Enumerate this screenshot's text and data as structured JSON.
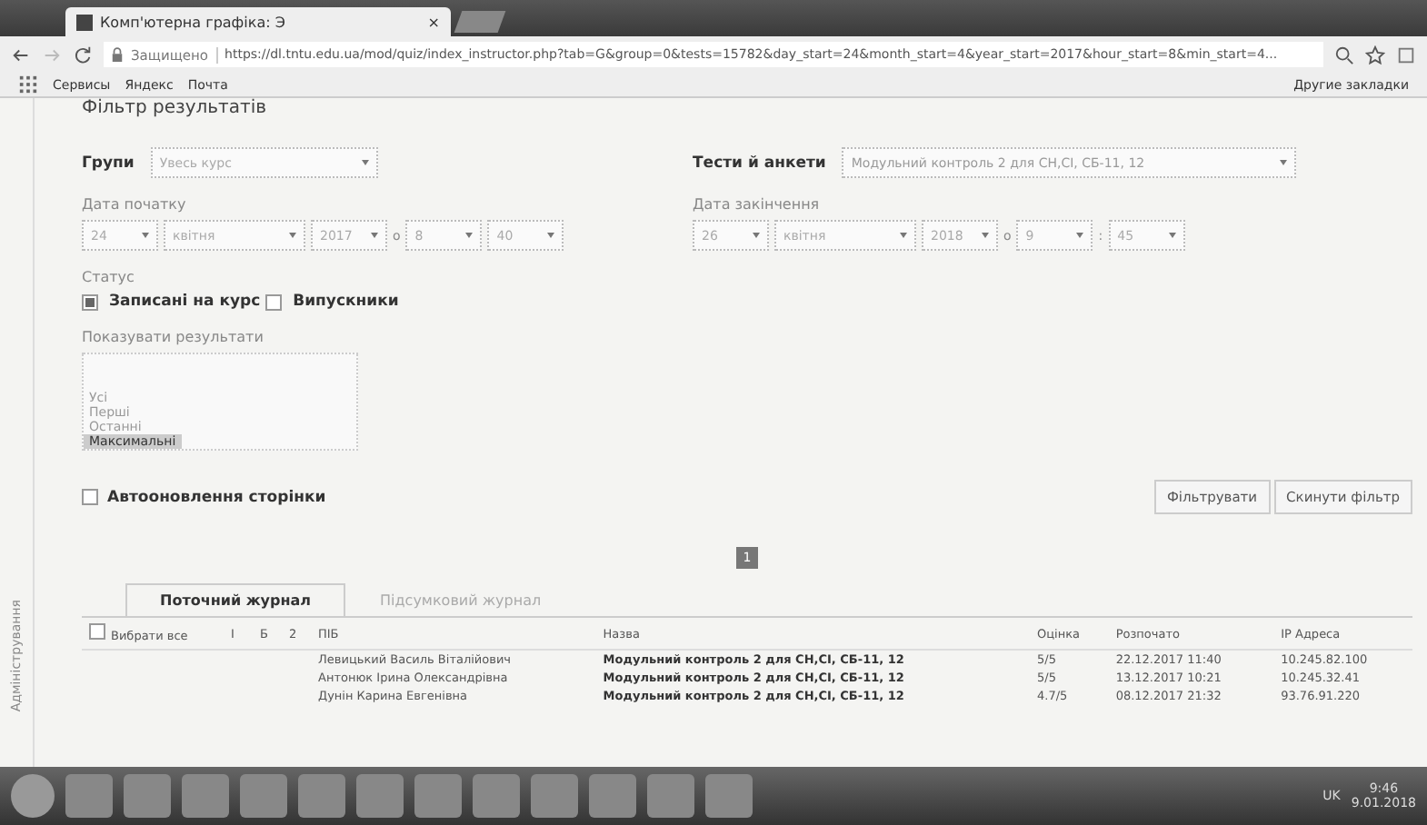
{
  "browser": {
    "tab_title": "Комп'ютерна графіка: Э",
    "tab_close": "×",
    "secure_label": "Защищено",
    "url": "https://dl.tntu.edu.ua/mod/quiz/index_instructor.php?tab=G&group=0&tests=15782&day_start=24&month_start=4&year_start=2017&hour_start=8&min_start=4...",
    "bookmarks": [
      "Сервисы",
      "Яндекс",
      "Почта"
    ],
    "other_bookmarks": "Другие закладки"
  },
  "sidebar_label": "Адміністрування",
  "filter": {
    "title": "Фільтр результатів",
    "groups": {
      "label": "Групи",
      "value": "Увесь курс"
    },
    "tests": {
      "label": "Тести й анкети",
      "value": "Модульний контроль 2 для СН,СІ, СБ-11, 12"
    },
    "start": {
      "label": "Дата початку",
      "day": "24",
      "month": "квітня",
      "year": "2017",
      "at": "о",
      "hour": "8",
      "minute": "40"
    },
    "end": {
      "label": "Дата закінчення",
      "day": "26",
      "month": "квітня",
      "year": "2018",
      "at": "о",
      "hour": "9",
      "sep": ":",
      "minute": "45"
    },
    "status_label": "Статус",
    "statuses": [
      {
        "label": "Записані на курс",
        "checked": true
      },
      {
        "label": "Випускники",
        "checked": false
      }
    ],
    "show_label": "Показувати результати",
    "show_options": [
      {
        "label": "Усі",
        "selected": false
      },
      {
        "label": "Перші",
        "selected": false
      },
      {
        "label": "Останні",
        "selected": false
      },
      {
        "label": "Максимальні",
        "selected": true
      }
    ],
    "autorefresh": {
      "label": "Автооновлення сторінки",
      "checked": false
    },
    "buttons": [
      "Фільтрувати",
      "Скинути фільтр"
    ]
  },
  "pages": [
    {
      "label": "1",
      "selected": true
    }
  ],
  "tabs": [
    {
      "label": "Поточний журнал",
      "selected": true
    },
    {
      "label": "Підсумковий журнал",
      "selected": false
    }
  ],
  "table": {
    "select_all": {
      "label": "Вибрати все",
      "checked": false
    },
    "small_columns": [
      "І",
      "Б",
      "2"
    ],
    "columns": [
      "ПІБ",
      "Назва",
      "Оцінка",
      "Розпочато",
      "IP Адреса"
    ],
    "rows": [
      [
        "Левицький Василь Віталійович",
        "Модульний контроль 2 для СН,СІ, СБ-11, 12",
        "5/5",
        "22.12.2017 11:40",
        "10.245.82.100"
      ],
      [
        "Антонюк Ірина Олександрівна",
        "Модульний контроль 2 для СН,СІ, СБ-11, 12",
        "5/5",
        "13.12.2017 10:21",
        "10.245.32.41"
      ],
      [
        "Дунін Карина Евгенівна",
        "Модульний контроль 2 для СН,СІ, СБ-11, 12",
        "4.7/5",
        "08.12.2017 21:32",
        "93.76.91.220"
      ]
    ]
  },
  "taskbar": {
    "language": "UK",
    "time": "9:46",
    "date": "9.01.2018"
  }
}
